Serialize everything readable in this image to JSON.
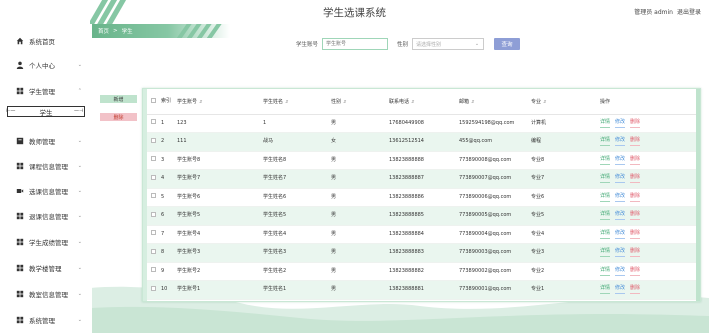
{
  "header": {
    "title": "学生选课系统",
    "user_label": "管理员 admin",
    "logout_label": "退出登录"
  },
  "breadcrumb": [
    "首页",
    "学生"
  ],
  "sidebar": {
    "items": [
      {
        "label": "系统首页",
        "icon": "home-icon",
        "chevron": false
      },
      {
        "label": "个人中心",
        "icon": "user-icon",
        "chevron": true
      },
      {
        "label": "学生管理",
        "icon": "grid-icon",
        "chevron": true
      },
      {
        "label": "教师管理",
        "icon": "book-icon",
        "chevron": true
      },
      {
        "label": "课程信息管理",
        "icon": "grid-icon",
        "chevron": true
      },
      {
        "label": "选课信息管理",
        "icon": "video-icon",
        "chevron": true
      },
      {
        "label": "退课信息管理",
        "icon": "grid-icon",
        "chevron": true
      },
      {
        "label": "学生成绩管理",
        "icon": "grid-icon",
        "chevron": true
      },
      {
        "label": "教学楼管理",
        "icon": "grid-icon",
        "chevron": true
      },
      {
        "label": "教室信息管理",
        "icon": "grid-icon",
        "chevron": true
      },
      {
        "label": "系统管理",
        "icon": "grid-icon",
        "chevron": true
      }
    ],
    "submenu_active": "学生"
  },
  "search": {
    "account_label": "学生账号",
    "account_placeholder": "学生账号",
    "gender_label": "性别",
    "gender_placeholder": "请选择性别",
    "search_button": "查询"
  },
  "actions": {
    "add_label": "新增",
    "delete_label": "删除"
  },
  "table": {
    "headers": [
      "索引",
      "学生账号",
      "学生姓名",
      "性别",
      "联系电话",
      "邮箱",
      "专业",
      "操作"
    ],
    "op_labels": {
      "detail": "详情",
      "edit": "修改",
      "delete": "删除"
    },
    "rows": [
      {
        "index": "1",
        "account": "123",
        "name": "1",
        "gender": "男",
        "phone": "17680449908",
        "email": "1592594198@qq.com",
        "major": "计算机"
      },
      {
        "index": "2",
        "account": "111",
        "name": "战马",
        "gender": "女",
        "phone": "13612512514",
        "email": "455@qq.com",
        "major": "编程"
      },
      {
        "index": "3",
        "account": "学生账号8",
        "name": "学生姓名8",
        "gender": "男",
        "phone": "13823888888",
        "email": "773890008@qq.com",
        "major": "专业8"
      },
      {
        "index": "4",
        "account": "学生账号7",
        "name": "学生姓名7",
        "gender": "男",
        "phone": "13823888887",
        "email": "773890007@qq.com",
        "major": "专业7"
      },
      {
        "index": "5",
        "account": "学生账号6",
        "name": "学生姓名6",
        "gender": "男",
        "phone": "13823888886",
        "email": "773890006@qq.com",
        "major": "专业6"
      },
      {
        "index": "6",
        "account": "学生账号5",
        "name": "学生姓名5",
        "gender": "男",
        "phone": "13823888885",
        "email": "773890005@qq.com",
        "major": "专业5"
      },
      {
        "index": "7",
        "account": "学生账号4",
        "name": "学生姓名4",
        "gender": "男",
        "phone": "13823888884",
        "email": "773890004@qq.com",
        "major": "专业4"
      },
      {
        "index": "8",
        "account": "学生账号3",
        "name": "学生姓名3",
        "gender": "男",
        "phone": "13823888883",
        "email": "773890003@qq.com",
        "major": "专业3"
      },
      {
        "index": "9",
        "account": "学生账号2",
        "name": "学生姓名2",
        "gender": "男",
        "phone": "13823888882",
        "email": "773890002@qq.com",
        "major": "专业2"
      },
      {
        "index": "10",
        "account": "学生账号1",
        "name": "学生姓名1",
        "gender": "男",
        "phone": "13823888881",
        "email": "773890001@qq.com",
        "major": "专业1"
      }
    ]
  },
  "colors": {
    "accent_green": "#86c7a4",
    "search_button": "#8e9ed6",
    "delete_red": "#e05b6b",
    "edit_blue": "#4a90d9"
  }
}
